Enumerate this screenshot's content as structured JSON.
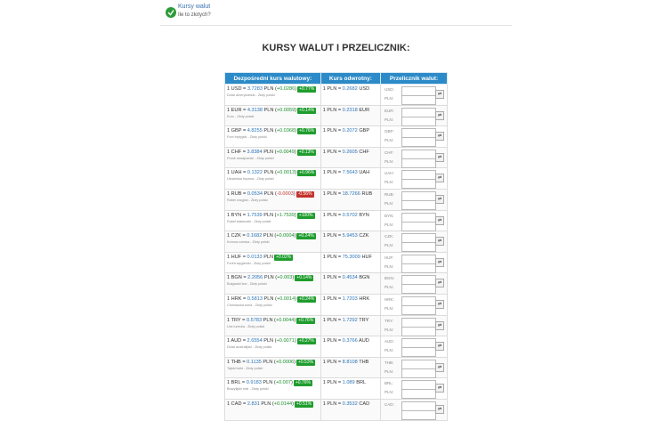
{
  "notification": {
    "title": "Kursy walut",
    "subtitle": "Ile to złotych?"
  },
  "page_title": "KURSY WALUT I PRZELICZNIK:",
  "table": {
    "headers": [
      "Dezpośredni kurs walutowy:",
      "Kurs odwrotny:",
      "Przelicznik walut:"
    ],
    "rows": [
      {
        "code": "USD",
        "rate": "3.7283",
        "change": "+0.0286",
        "pct": "+0.77%",
        "dir": "up",
        "name": "Dolar amerykański - Złoty polski",
        "inverse": "0.2682",
        "pln": "PLN:",
        "from": "USD:"
      },
      {
        "code": "EUR",
        "rate": "4.3138",
        "change": "+0.0059",
        "pct": "+0.14%",
        "dir": "up",
        "name": "Euro - Złoty polski",
        "inverse": "0.2318",
        "pln": "PLN:",
        "from": "EUR:"
      },
      {
        "code": "GBP",
        "rate": "4.8255",
        "change": "+0.0368",
        "pct": "+0.76%",
        "dir": "up",
        "name": "Funt brytyjski - Złoty polski",
        "inverse": "0.2072",
        "pln": "PLN:",
        "from": "GBP:"
      },
      {
        "code": "CHF",
        "rate": "3.8384",
        "change": "+0.0049",
        "pct": "+0.13%",
        "dir": "up",
        "name": "Frank szwajcarski - Złoty polski",
        "inverse": "0.2605",
        "pln": "PLN:",
        "from": "CHF:"
      },
      {
        "code": "UAH",
        "rate": "0.1322",
        "change": "+0.0013",
        "pct": "+0.96%",
        "dir": "up",
        "name": "Ukraińska hrywna - Złoty polski",
        "inverse": "7.5643",
        "pln": "PLN:",
        "from": "UAH:"
      },
      {
        "code": "RUB",
        "rate": "0.0534",
        "change": "-0.0003",
        "pct": "-0.56%",
        "dir": "down",
        "name": "Rubel rosyjski - Złoty polski",
        "inverse": "18.7266",
        "pln": "PLN:",
        "from": "RUB:"
      },
      {
        "code": "BYN",
        "rate": "1.7539",
        "change": "+1.7539",
        "pct": "+100%",
        "dir": "up",
        "name": "Rubel białoruski - Złoty polski",
        "inverse": "0.5702",
        "pln": "PLN:",
        "from": "BYN:"
      },
      {
        "code": "CZK",
        "rate": "0.1682",
        "change": "+0.0004",
        "pct": "+0.24%",
        "dir": "up",
        "name": "Korona czeska - Złoty polski",
        "inverse": "5.9453",
        "pln": "PLN:",
        "from": "CZK:"
      },
      {
        "code": "HUF",
        "rate": "0.0133",
        "change": "",
        "pct": "+0.02%",
        "dir": "up",
        "name": "Forint węgierski - Złoty polski",
        "inverse": "75.3009",
        "pln": "PLN:",
        "from": "HUF:"
      },
      {
        "code": "BGN",
        "rate": "2.2056",
        "change": "+0.003",
        "pct": "+0.14%",
        "dir": "up",
        "name": "Bułgarski lew - Złoty polski",
        "inverse": "0.4534",
        "pln": "PLN:",
        "from": "BGN:"
      },
      {
        "code": "HRK",
        "rate": "0.5813",
        "change": "+0.0014",
        "pct": "+0.24%",
        "dir": "up",
        "name": "Chorwacka kuna - Złoty polski",
        "inverse": "1.7203",
        "pln": "PLN:",
        "from": "HRK:"
      },
      {
        "code": "TRY",
        "rate": "0.5783",
        "change": "+0.0044",
        "pct": "+0.76%",
        "dir": "up",
        "name": "Lira turecka - Złoty polski",
        "inverse": "1.7292",
        "pln": "PLN:",
        "from": "TRY:"
      },
      {
        "code": "AUD",
        "rate": "2.6554",
        "change": "+0.0071",
        "pct": "+0.27%",
        "dir": "up",
        "name": "Dolar australijski - Złoty polski",
        "inverse": "0.3766",
        "pln": "PLN:",
        "from": "AUD:"
      },
      {
        "code": "THB",
        "rate": "0.1135",
        "change": "+0.0006",
        "pct": "+0.53%",
        "dir": "up",
        "name": "Tajski baht - Złoty polski",
        "inverse": "8.8108",
        "pln": "PLN:",
        "from": "THB:"
      },
      {
        "code": "BRL",
        "rate": "0.9183",
        "change": "+0.007",
        "pct": "+0.76%",
        "dir": "up",
        "name": "Brazylijski real - Złoty polski",
        "inverse": "1.089",
        "pln": "PLN:",
        "from": "BRL:"
      },
      {
        "code": "CAD",
        "rate": "2.831",
        "change": "+0.0144",
        "pct": "+0.51%",
        "dir": "up",
        "name": "",
        "inverse": "0.3532",
        "pln": "",
        "from": "CAD:"
      }
    ]
  },
  "icons": {
    "logo": "currency-logo-icon",
    "convert": "convert-icon"
  },
  "colors": {
    "header_bg": "#2b8ac7",
    "up": "#1f9d2e",
    "down": "#c3322c",
    "link": "#2a74b8"
  }
}
